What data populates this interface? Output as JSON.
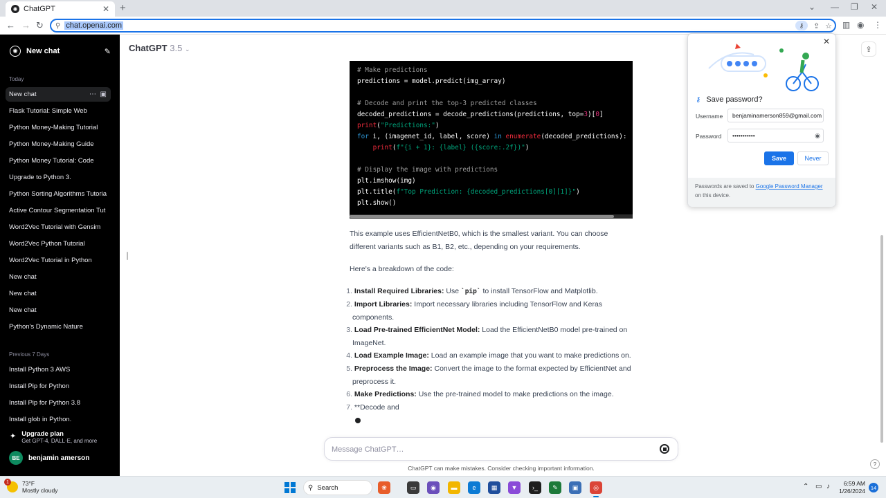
{
  "browser": {
    "tab_title": "ChatGPT",
    "tab_favicon": "openai-icon",
    "url": "chat.openai.com"
  },
  "sidebar": {
    "new_chat_label": "New chat",
    "section_today": "Today",
    "today_items": [
      "New chat",
      "Flask Tutorial: Simple Web",
      "Python Money-Making Tutorial",
      "Python Money-Making Guide",
      "Python Money Tutorial: Code",
      "Upgrade to Python 3.",
      "Python Sorting Algorithms Tutoria",
      "Active Contour Segmentation Tut",
      "Word2Vec Tutorial with Gensim",
      "Word2Vec Python Tutorial",
      "Word2Vec Tutorial in Python",
      "New chat",
      "New chat",
      "New chat",
      "Python's Dynamic Nature"
    ],
    "section_prev7": "Previous 7 Days",
    "prev7_items": [
      "Install Python 3 AWS",
      "Install Pip for Python",
      "Install Pip for Python 3.8",
      "Install glob in Python."
    ],
    "upgrade_title": "Upgrade plan",
    "upgrade_sub": "Get GPT-4, DALL·E, and more",
    "user_initials": "BE",
    "user_name": "benjamin amerson"
  },
  "header": {
    "model_name": "ChatGPT",
    "model_version": "3.5"
  },
  "code": {
    "lines": [
      "# Make predictions",
      "predictions = model.predict(img_array)",
      "",
      "# Decode and print the top-3 predicted classes",
      "decoded_predictions = decode_predictions(predictions, top=3)[0]",
      "print(\"Predictions:\")",
      "for i, (imagenet_id, label, score) in enumerate(decoded_predictions):",
      "    print(f\"{i + 1}: {label} ({score:.2f})\")",
      "",
      "# Display the image with predictions",
      "plt.imshow(img)",
      "plt.title(f\"Top Prediction: {decoded_predictions[0][1]}\")",
      "plt.show()"
    ]
  },
  "message": {
    "paragraph1": "This example uses EfficientNetB0, which is the smallest variant. You can choose different variants such as B1, B2, etc., depending on your requirements.",
    "paragraph2": "Here's a breakdown of the code:",
    "list": [
      {
        "num": "1.",
        "bold": "Install Required Libraries:",
        "pre": " Use ",
        "code": "`pip`",
        "post": " to install TensorFlow and Matplotlib."
      },
      {
        "num": "2.",
        "bold": "Import Libraries:",
        "pre": " Import necessary libraries including TensorFlow and Keras components.",
        "code": "",
        "post": ""
      },
      {
        "num": "3.",
        "bold": "Load Pre-trained EfficientNet Model:",
        "pre": " Load the EfficientNetB0 model pre-trained on ImageNet.",
        "code": "",
        "post": ""
      },
      {
        "num": "4.",
        "bold": "Load Example Image:",
        "pre": " Load an example image that you want to make predictions on.",
        "code": "",
        "post": ""
      },
      {
        "num": "5.",
        "bold": "Preprocess the Image:",
        "pre": " Convert the image to the format expected by EfficientNet and preprocess it.",
        "code": "",
        "post": ""
      },
      {
        "num": "6.",
        "bold": "Make Predictions:",
        "pre": " Use the pre-trained model to make predictions on the image.",
        "code": "",
        "post": ""
      },
      {
        "num": "7.",
        "bold": "",
        "pre": "**Decode and",
        "code": "",
        "post": ""
      }
    ]
  },
  "composer": {
    "placeholder": "Message ChatGPT…",
    "disclaimer": "ChatGPT can make mistakes. Consider checking important information."
  },
  "password_popup": {
    "title": "Save password?",
    "username_label": "Username",
    "username_value": "benjaminamerson859@gmail.com",
    "password_label": "Password",
    "password_value": "•••••••••••",
    "save_label": "Save",
    "never_label": "Never",
    "footer_pre": "Passwords are saved to ",
    "footer_link": "Google Password Manager",
    "footer_post": " on this device."
  },
  "taskbar": {
    "weather_badge": "1",
    "temperature": "73°F",
    "weather_desc": "Mostly cloudy",
    "search_label": "Search",
    "time": "6:59 AM",
    "date": "1/26/2024",
    "notification_count": "14"
  },
  "colors": {
    "sidebar_bg": "#000000",
    "accent_blue": "#1a73e8",
    "avatar_green": "#0e8a5f"
  }
}
